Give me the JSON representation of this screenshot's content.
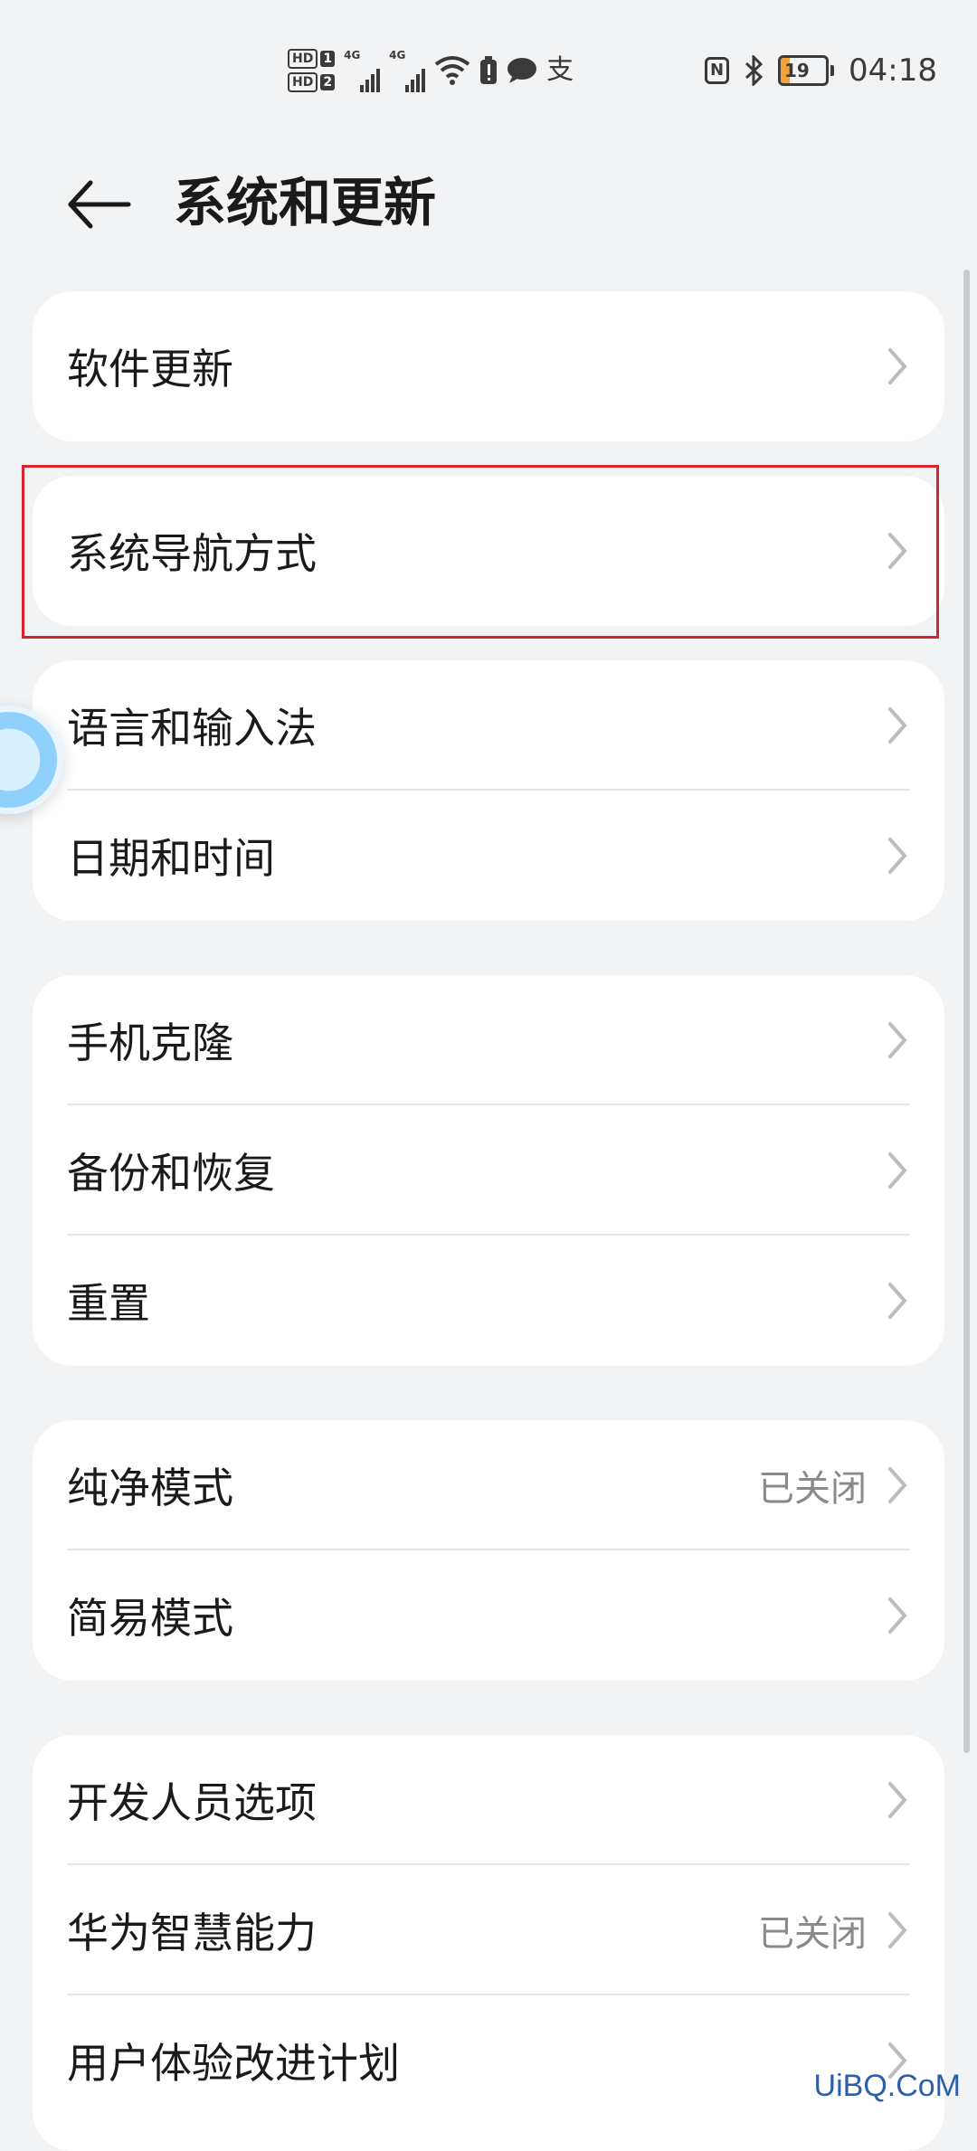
{
  "status_bar": {
    "hd1": "HD",
    "hd1_num": "1",
    "hd2": "HD",
    "hd2_num": "2",
    "sim1_network": "4G",
    "sim2_network": "4G",
    "alipay_icon_text": "支",
    "nfc": "N",
    "battery": "19",
    "battery_level": 0.19,
    "time": "04:18",
    "battery_color": "#f4a23a"
  },
  "header": {
    "title": "系统和更新"
  },
  "groups": [
    {
      "items": [
        {
          "label": "软件更新"
        }
      ]
    },
    {
      "items": [
        {
          "label": "系统导航方式"
        }
      ]
    },
    {
      "items": [
        {
          "label": "语言和输入法"
        },
        {
          "label": "日期和时间"
        }
      ]
    },
    {
      "items": [
        {
          "label": "手机克隆"
        },
        {
          "label": "备份和恢复"
        },
        {
          "label": "重置"
        }
      ]
    },
    {
      "items": [
        {
          "label": "纯净模式",
          "value": "已关闭"
        },
        {
          "label": "简易模式"
        }
      ]
    },
    {
      "items": [
        {
          "label": "开发人员选项"
        },
        {
          "label": "华为智慧能力",
          "value": "已关闭"
        },
        {
          "label": "用户体验改进计划"
        }
      ]
    }
  ],
  "watermark": "UiBQ.CoM",
  "colors": {
    "background": "#f1f3f5",
    "card": "#ffffff",
    "highlight_border": "#d9232a",
    "secondary_text": "#8a8a8a"
  }
}
